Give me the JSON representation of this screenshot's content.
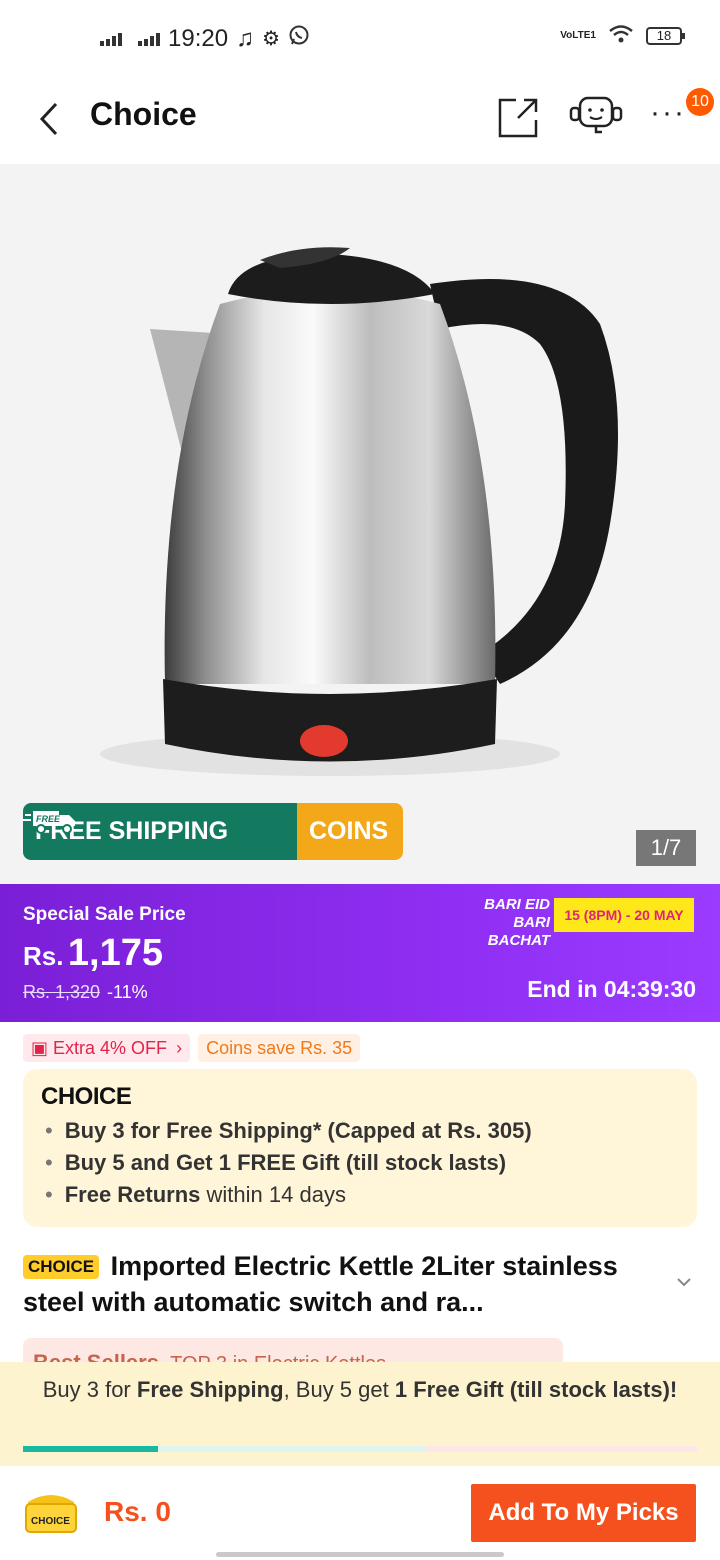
{
  "status_bar": {
    "time": "19:20",
    "network": "VoLTE1",
    "battery": "18"
  },
  "header": {
    "title": "Choice",
    "notification_count": "10"
  },
  "gallery": {
    "product_image": "electric-kettle",
    "free_shipping_label": "FREE SHIPPING",
    "free_tag": "FREE",
    "coins_label": "COINS",
    "image_counter": "1/7"
  },
  "price": {
    "sale_label": "Special Sale Price",
    "currency": "Rs.",
    "amount": "1,175",
    "original": "Rs. 1,320",
    "discount": "-11%",
    "campaign_line1": "BARI EID",
    "campaign_line2": "BARI BACHAT",
    "campaign_dates": "15 (8PM) - 20 MAY",
    "countdown": "End in 04:39:30"
  },
  "promos": {
    "extra_off": "Extra 4% OFF",
    "coins_save": "Coins save Rs. 35"
  },
  "choice_box": {
    "logo": "CHOICE",
    "item1_bold": "Buy 3 for  Free Shipping* (Capped at Rs. 305)",
    "item2_bold": "Buy 5 and Get 1 FREE Gift (till stock lasts)",
    "item3_bold": "Free Returns",
    "item3_rest": " within 14 days"
  },
  "product": {
    "badge": "CHOICE",
    "title": "Imported Electric Kettle 2Liter stainless steel with automatic switch and ra..."
  },
  "bestseller": {
    "label": "Best Sellers",
    "rank": "TOP 3 in Electric Kettles"
  },
  "buy_banner": {
    "part1": "Buy 3 for ",
    "part2": "Free Shipping",
    "part3": ", Buy 5 get ",
    "part4": "1 Free Gift (till stock lasts)!",
    "progress_fraction": 0.2
  },
  "bottom_bar": {
    "cart_label": "CHOICE",
    "total": "Rs. 0",
    "add_button": "Add To My Picks"
  },
  "colors": {
    "accent": "#f4511e",
    "purple": "#8f2ef2",
    "green": "#137a5f",
    "gold": "#f3a81a"
  }
}
